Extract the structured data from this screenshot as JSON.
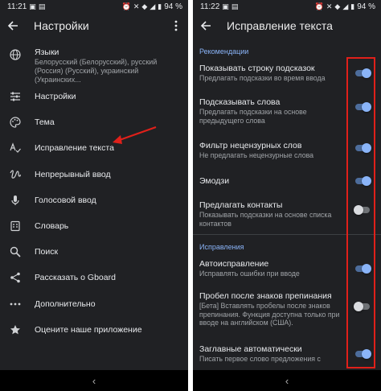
{
  "left": {
    "status": {
      "time": "11:21",
      "battery": "94 %"
    },
    "title": "Настройки",
    "items": [
      {
        "label": "Языки",
        "sub": "Белорусский (Белорусский), русский (Россия) (Русский), украинский (Украинских...",
        "icon": "globe-icon"
      },
      {
        "label": "Настройки",
        "icon": "sliders-icon"
      },
      {
        "label": "Тема",
        "icon": "palette-icon"
      },
      {
        "label": "Исправление текста",
        "icon": "text-correction-icon"
      },
      {
        "label": "Непрерывный ввод",
        "icon": "gesture-icon"
      },
      {
        "label": "Голосовой ввод",
        "icon": "microphone-icon"
      },
      {
        "label": "Словарь",
        "icon": "dictionary-icon"
      },
      {
        "label": "Поиск",
        "icon": "search-icon"
      },
      {
        "label": "Рассказать о Gboard",
        "icon": "share-icon"
      },
      {
        "label": "Дополнительно",
        "icon": "more-horizontal-icon"
      },
      {
        "label": "Оцените наше приложение",
        "icon": "star-icon"
      }
    ]
  },
  "right": {
    "status": {
      "time": "11:22",
      "battery": "94 %"
    },
    "title": "Исправление текста",
    "sections": [
      {
        "header": "Рекомендации",
        "settings": [
          {
            "title": "Показывать строку подсказок",
            "sub": "Предлагать подсказки во время ввода",
            "on": true
          },
          {
            "title": "Подсказывать слова",
            "sub": "Предлагать подсказки на основе предыдущего слова",
            "on": true
          },
          {
            "title": "Фильтр нецензурных слов",
            "sub": "Не предлагать нецензурные слова",
            "on": true
          },
          {
            "title": "Эмодзи",
            "sub": "",
            "on": true
          },
          {
            "title": "Предлагать контакты",
            "sub": "Показывать подсказки на основе списка контактов",
            "on": false
          }
        ]
      },
      {
        "header": "Исправления",
        "settings": [
          {
            "title": "Автоисправление",
            "sub": "Исправлять ошибки при вводе",
            "on": true
          },
          {
            "title": "Пробел после знаков препинания",
            "sub": "[Бета] Вставлять пробелы после знаков препинания. Функция доступна только при вводе на английском (США).",
            "on": false
          },
          {
            "title": "Заглавные автоматически",
            "sub": "Писать первое слово предложения с",
            "on": true
          }
        ]
      }
    ]
  },
  "colors": {
    "background": "#202124",
    "accent": "#8ab4f8",
    "annotation": "#e0201a"
  }
}
